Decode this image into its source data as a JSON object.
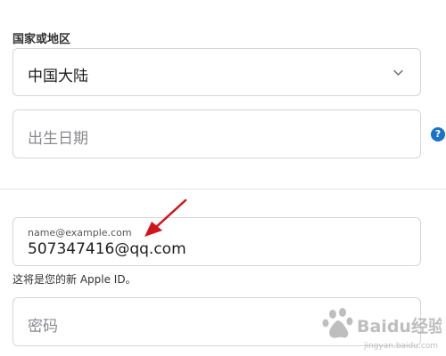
{
  "form": {
    "country_label": "国家或地区",
    "country_value": "中国大陆",
    "birthdate_placeholder": "出生日期",
    "help_glyph": "?",
    "email_label": "name@example.com",
    "email_value": "507347416@qq.com",
    "email_hint": "这将是您的新 Apple ID。",
    "password_placeholder": "密码"
  },
  "annotation": {
    "arrow_color": "#d0141a"
  },
  "watermark": {
    "text": "Baidu经验",
    "subtext": "jingyan.baidu.com"
  },
  "colors": {
    "help_icon": "#1a73c9",
    "field_border": "#d6d6d6"
  },
  "icons": {
    "country_select": "chevron-down-icon",
    "birthdate_help": "help-icon",
    "annotation": "arrow-icon"
  }
}
